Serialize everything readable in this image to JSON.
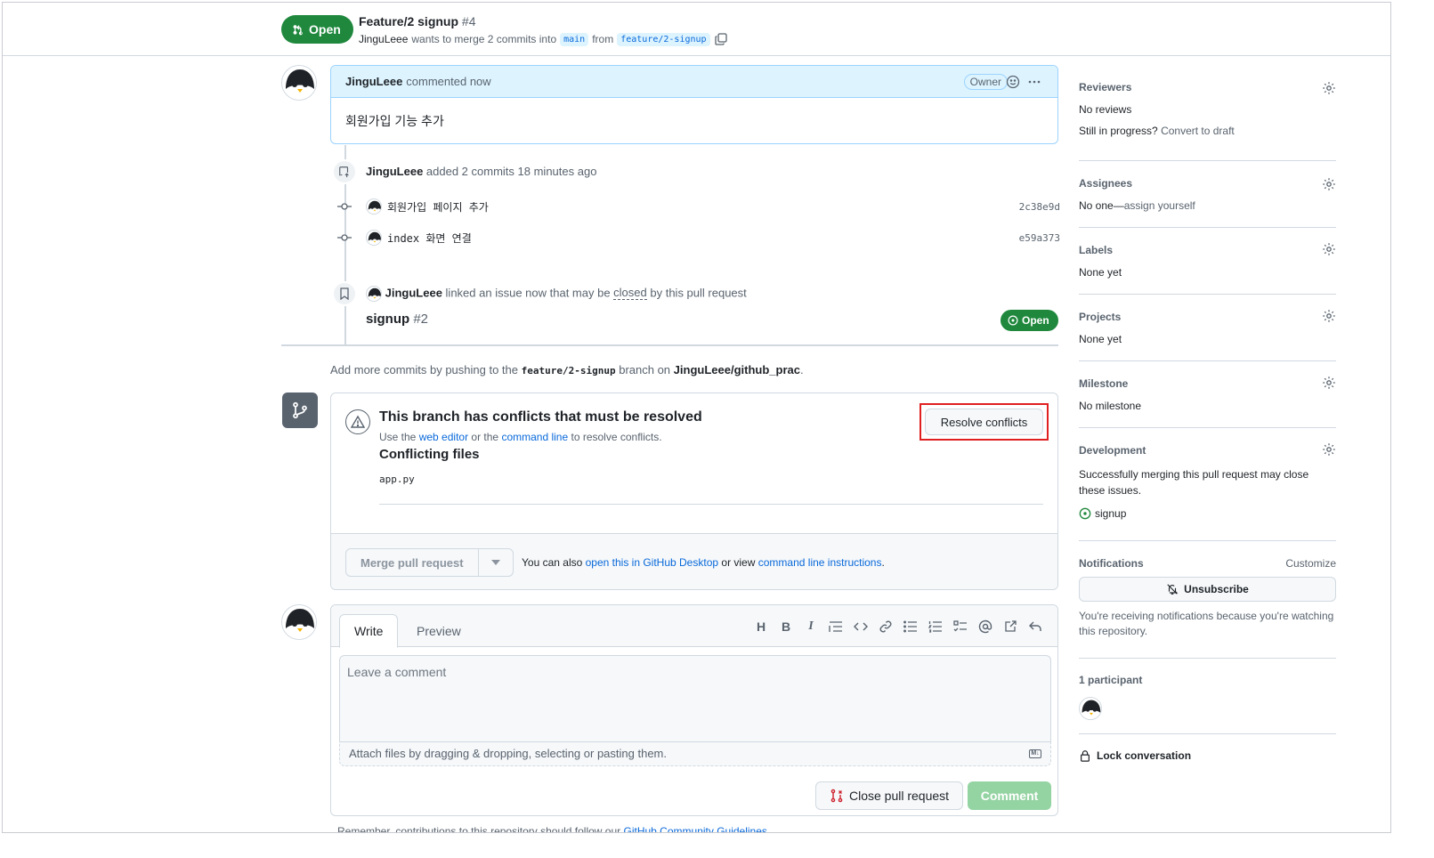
{
  "header": {
    "state": "Open",
    "title": "Feature/2 signup",
    "number": "#4",
    "author": "JinguLeee",
    "merge_text": "wants to merge 2 commits into",
    "base_branch": "main",
    "from_text": "from",
    "head_branch": "feature/2-signup"
  },
  "comment": {
    "author": "JinguLeee",
    "time": "commented now",
    "badge": "Owner",
    "body": "회원가입 기능 추가"
  },
  "commits_event": {
    "author": "JinguLeee",
    "text": "added 2 commits 18 minutes ago",
    "commits": [
      {
        "message": "회원가입 페이지 추가",
        "sha": "2c38e9d"
      },
      {
        "message": "index 화면 연결",
        "sha": "e59a373"
      }
    ]
  },
  "linked_issue": {
    "author": "JinguLeee",
    "text_prefix": "linked an issue now that may be",
    "closed_word": "closed",
    "text_suffix": "by this pull request",
    "issue_title": "signup",
    "issue_number": "#2",
    "issue_state": "Open"
  },
  "push_hint": {
    "prefix": "Add more commits by pushing to the",
    "branch": "feature/2-signup",
    "middle": "branch on",
    "repo": "JinguLeee/github_prac",
    "suffix": "."
  },
  "merge_box": {
    "conflict_title": "This branch has conflicts that must be resolved",
    "sub_prefix": "Use the",
    "web_editor": "web editor",
    "sub_middle": "or the",
    "command_line": "command line",
    "sub_suffix": "to resolve conflicts.",
    "files_heading": "Conflicting files",
    "files": [
      "app.py"
    ],
    "resolve_button": "Resolve conflicts",
    "merge_button": "Merge pull request",
    "note_prefix": "You can also",
    "desktop_link": "open this in GitHub Desktop",
    "note_middle": "or view",
    "cli_link": "command line instructions",
    "note_suffix": "."
  },
  "comment_form": {
    "tab_write": "Write",
    "tab_preview": "Preview",
    "placeholder": "Leave a comment",
    "attach_text": "Attach files by dragging & dropping, selecting or pasting them.",
    "md_badge": "M↓",
    "close_button": "Close pull request",
    "comment_button": "Comment",
    "guidelines_prefix": "Remember, contributions to this repository should follow our",
    "guidelines_link": "GitHub Community Guidelines"
  },
  "sidebar": {
    "reviewers": {
      "title": "Reviewers",
      "value": "No reviews",
      "draft_prefix": "Still in progress?",
      "draft_link": "Convert to draft"
    },
    "assignees": {
      "title": "Assignees",
      "value_prefix": "No one—",
      "value_link": "assign yourself"
    },
    "labels": {
      "title": "Labels",
      "value": "None yet"
    },
    "projects": {
      "title": "Projects",
      "value": "None yet"
    },
    "milestone": {
      "title": "Milestone",
      "value": "No milestone"
    },
    "development": {
      "title": "Development",
      "value": "Successfully merging this pull request may close these issues.",
      "issue": "signup"
    },
    "notifications": {
      "title": "Notifications",
      "customize": "Customize",
      "button": "Unsubscribe",
      "reason": "You're receiving notifications because you're watching this repository."
    },
    "participants": {
      "title": "1 participant"
    },
    "lock": "Lock conversation"
  },
  "colors": {
    "open_green": "#1f883d",
    "link_blue": "#0969da",
    "highlight_red": "#e02020"
  }
}
